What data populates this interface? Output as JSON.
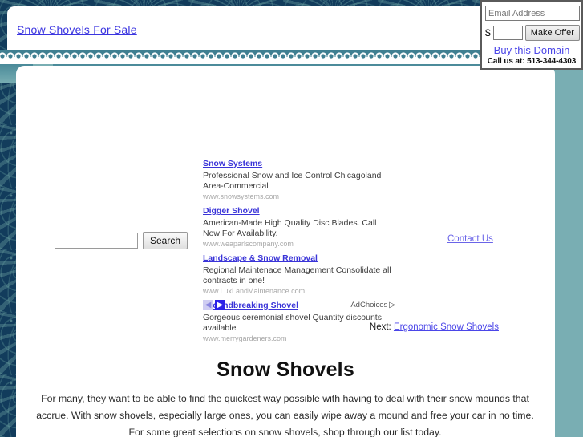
{
  "header": {
    "site_link": "Snow Shovels For Sale"
  },
  "domain_box": {
    "email_placeholder": "Email Address",
    "email_value": "",
    "dollar_sign": "$",
    "price_value": "",
    "make_offer_label": "Make Offer",
    "buy_domain_label": "Buy this Domain",
    "call_us": "Call us at: 513-344-4303"
  },
  "search": {
    "value": "",
    "button_label": "Search"
  },
  "contact": {
    "label": "Contact Us"
  },
  "ads": {
    "items": [
      {
        "title": "Snow Systems",
        "description": "Professional Snow and Ice Control Chicagoland Area-Commercial",
        "url": "www.snowsystems.com"
      },
      {
        "title": "Digger Shovel",
        "description": "American-Made High Quality Disc Blades. Call Now For Availability.",
        "url": "www.weaparlscompany.com"
      },
      {
        "title": "Landscape & Snow Removal",
        "description": "Regional Maintenace Management Consolidate all contracts in one!",
        "url": "www.LuxLandMaintenance.com"
      },
      {
        "title": "Groundbreaking Shovel",
        "description": "Gorgeous ceremonial shovel Quantity discounts available",
        "url": "www.merrygardeners.com"
      }
    ],
    "prev_arrow": "◀",
    "next_arrow": "▶",
    "adchoices_label": "AdChoices",
    "adchoices_icon": "▷"
  },
  "next_nav": {
    "prefix": "Next:",
    "link_label": "Ergonomic Snow Shovels"
  },
  "main": {
    "title": "Snow Shovels",
    "paragraph": "For many, they want to be able to find the quickest way possible with having to deal with their snow mounds that accrue. With snow shovels, especially large ones, you can easily wipe away a mound and free your car in no time. For some great selections on snow shovels, shop through our list today."
  },
  "colors": {
    "background_navy": "#123c5c",
    "teal_rail": "#79aeb3",
    "teal_band_top": "#4a8a99",
    "link_blue": "#3b35e0",
    "ad_title_blue": "#3a34d8",
    "ad_url_gray": "#a9a9a9",
    "next_arrow_blue": "#2b22e8",
    "prev_arrow_lavender": "#cfcdf2"
  }
}
